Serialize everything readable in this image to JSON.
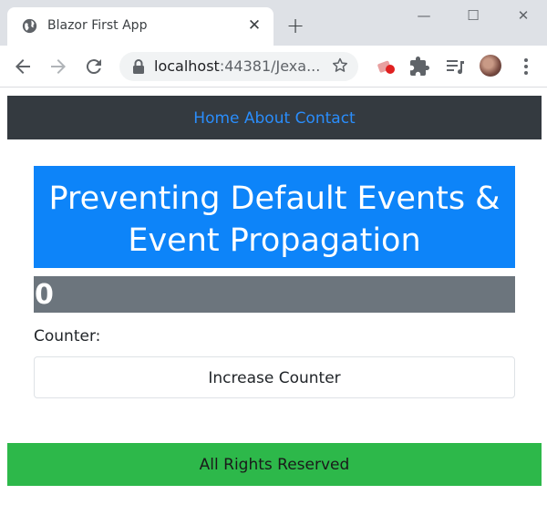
{
  "browser": {
    "tab_title": "Blazor First App",
    "url_host": "localhost",
    "url_rest": ":44381/Jexa..."
  },
  "nav": {
    "links": [
      "Home",
      "About",
      "Contact"
    ]
  },
  "page": {
    "heading_line1": "Preventing Default Events &",
    "heading_line2": "Event Propagation",
    "counter_value": "0",
    "counter_label": "Counter:",
    "increase_button_label": "Increase Counter",
    "footer_text": "All Rights Reserved"
  },
  "colors": {
    "navbar_bg": "#343a40",
    "nav_link": "#2a8dfb",
    "heading_bg": "#0d84f9",
    "counter_bg": "#6c757d",
    "footer_bg": "#2db84a"
  },
  "icons": {
    "tab_favicon": "globe-icon",
    "back": "back-arrow-icon",
    "forward": "forward-arrow-icon",
    "reload": "reload-icon",
    "lock": "lock-icon",
    "bookmark": "star-icon",
    "extensions": "puzzle-icon",
    "media": "media-queue-icon",
    "menu": "kebab-menu-icon"
  }
}
